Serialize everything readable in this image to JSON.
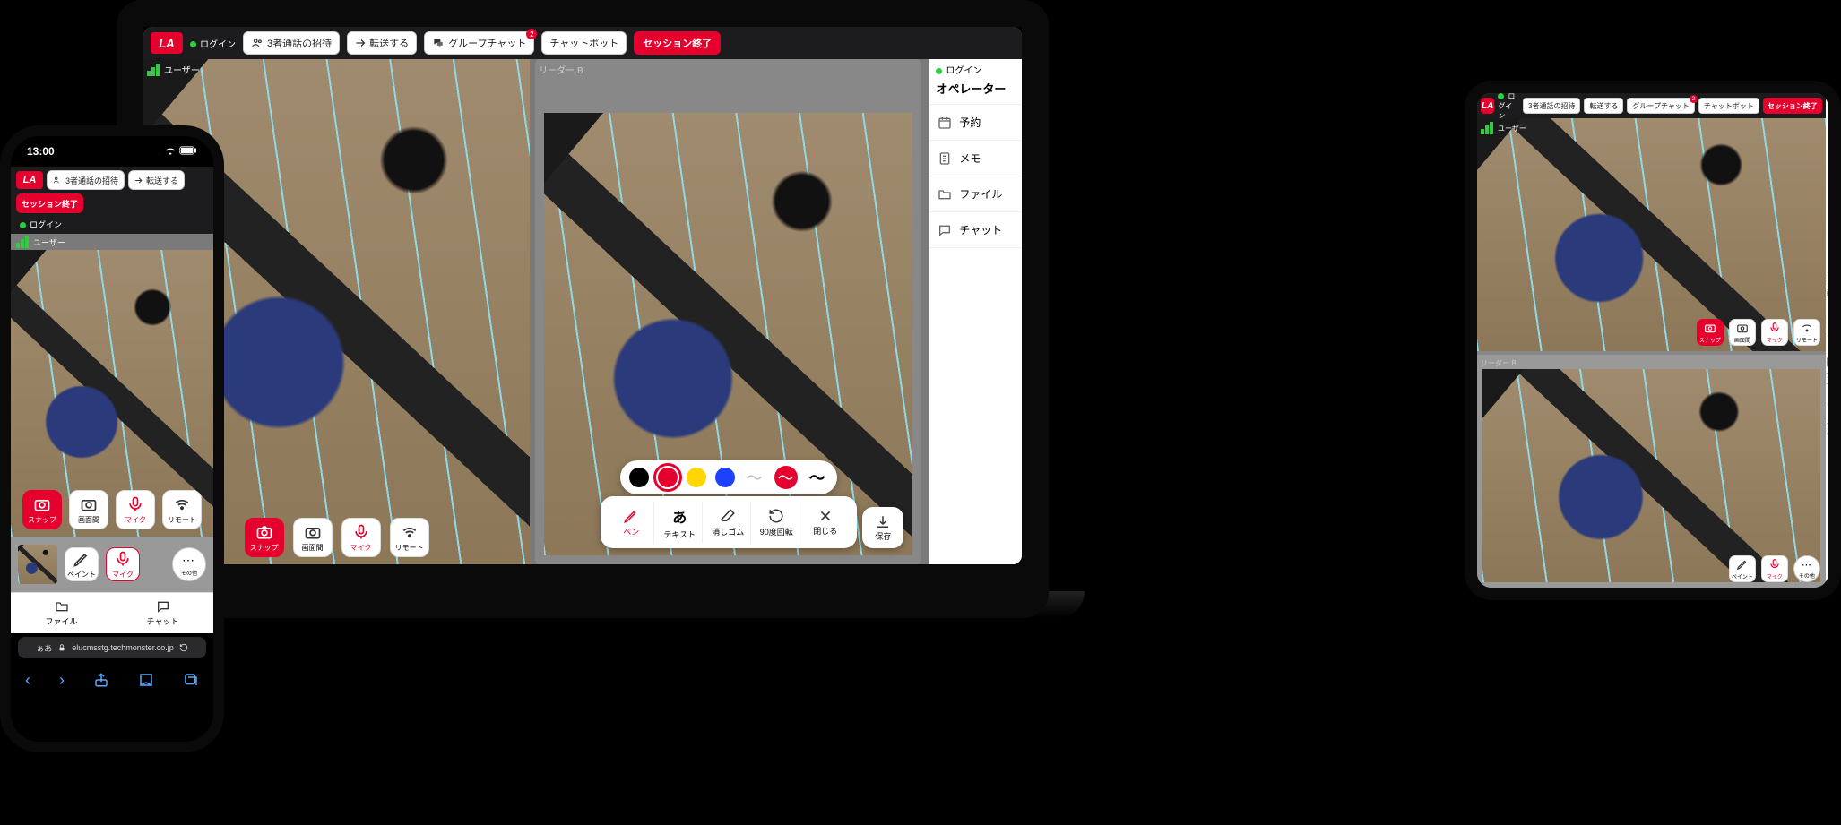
{
  "common": {
    "logo_text": "LA",
    "login_label": "ログイン",
    "user_tag": "ユーザー",
    "leader_tag": "リーダー B"
  },
  "toolbar": {
    "invite": "3者通話の招待",
    "transfer": "転送する",
    "group_chat": "グループチャット",
    "chatbot": "チャットボット",
    "end_session": "セッション終了",
    "badge_count": "2"
  },
  "controls": {
    "snap": "スナップ",
    "screen_share": "画面間",
    "mic": "マイク",
    "remote": "リモート",
    "paint": "ペイント",
    "more": "その他"
  },
  "colors": {
    "black": "#000000",
    "red": "#e6002d",
    "yellow": "#ffd600",
    "blue": "#1e40ff"
  },
  "edit_tools": {
    "pen": "ペン",
    "text": "テキスト",
    "text_symbol": "あ",
    "eraser": "消しゴム",
    "rotate": "90度回転",
    "close": "閉じる",
    "save": "保存"
  },
  "sidebar": {
    "title": "オペレーター",
    "items": [
      {
        "icon": "calendar",
        "label": "予約"
      },
      {
        "icon": "memo",
        "label": "メモ"
      },
      {
        "icon": "folder",
        "label": "ファイル"
      },
      {
        "icon": "chat",
        "label": "チャット"
      }
    ]
  },
  "phone": {
    "time": "13:00",
    "url_prefix": "ぁあ",
    "url": "elucmsstg.techmonster.co.jp",
    "bottom_file": "ファイル",
    "bottom_chat": "チャット"
  },
  "tablet_side": {
    "a": "画面",
    "b": "メモ",
    "c": "ファイル",
    "d": "チャット"
  }
}
